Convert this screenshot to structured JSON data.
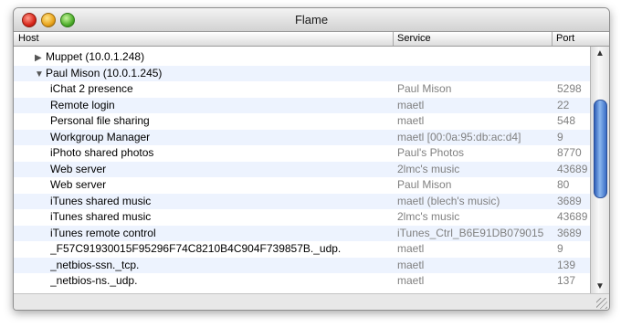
{
  "window": {
    "title": "Flame"
  },
  "columns": {
    "host": "Host",
    "service": "Service",
    "port": "Port"
  },
  "rows": [
    {
      "type": "group",
      "expanded": false,
      "host": "Muppet (10.0.1.248)",
      "service": "",
      "port": ""
    },
    {
      "type": "group",
      "expanded": true,
      "host": "Paul Mison (10.0.1.245)",
      "service": "",
      "port": ""
    },
    {
      "type": "item",
      "host": "iChat 2 presence",
      "service": "Paul Mison",
      "port": "5298"
    },
    {
      "type": "item",
      "host": "Remote login",
      "service": "maetl",
      "port": "22"
    },
    {
      "type": "item",
      "host": "Personal file sharing",
      "service": "maetl",
      "port": "548"
    },
    {
      "type": "item",
      "host": "Workgroup Manager",
      "service": "maetl [00:0a:95:db:ac:d4]",
      "port": "9"
    },
    {
      "type": "item",
      "host": "iPhoto shared photos",
      "service": "Paul's Photos",
      "port": "8770"
    },
    {
      "type": "item",
      "host": "Web server",
      "service": "2lmc's music",
      "port": "43689"
    },
    {
      "type": "item",
      "host": "Web server",
      "service": "Paul Mison",
      "port": "80"
    },
    {
      "type": "item",
      "host": "iTunes shared music",
      "service": "maetl (blech's music)",
      "port": "3689"
    },
    {
      "type": "item",
      "host": "iTunes shared music",
      "service": "2lmc's music",
      "port": "43689"
    },
    {
      "type": "item",
      "host": "iTunes remote control",
      "service": "iTunes_Ctrl_B6E91DB079015",
      "port": "3689"
    },
    {
      "type": "item",
      "host": "_F57C91930015F95296F74C8210B4C904F739857B._udp.",
      "service": "maetl",
      "port": "9"
    },
    {
      "type": "item",
      "host": "_netbios-ssn._tcp.",
      "service": "maetl",
      "port": "139"
    },
    {
      "type": "item",
      "host": "_netbios-ns._udp.",
      "service": "maetl",
      "port": "137"
    }
  ],
  "icons": {
    "collapsed": "▶",
    "expanded": "▼",
    "scroll_up": "▲",
    "scroll_down": "▼"
  },
  "colors": {
    "row_alt": "#edf3fe",
    "secondary_text": "#808080",
    "scroll_thumb": "#3a6dc6"
  }
}
